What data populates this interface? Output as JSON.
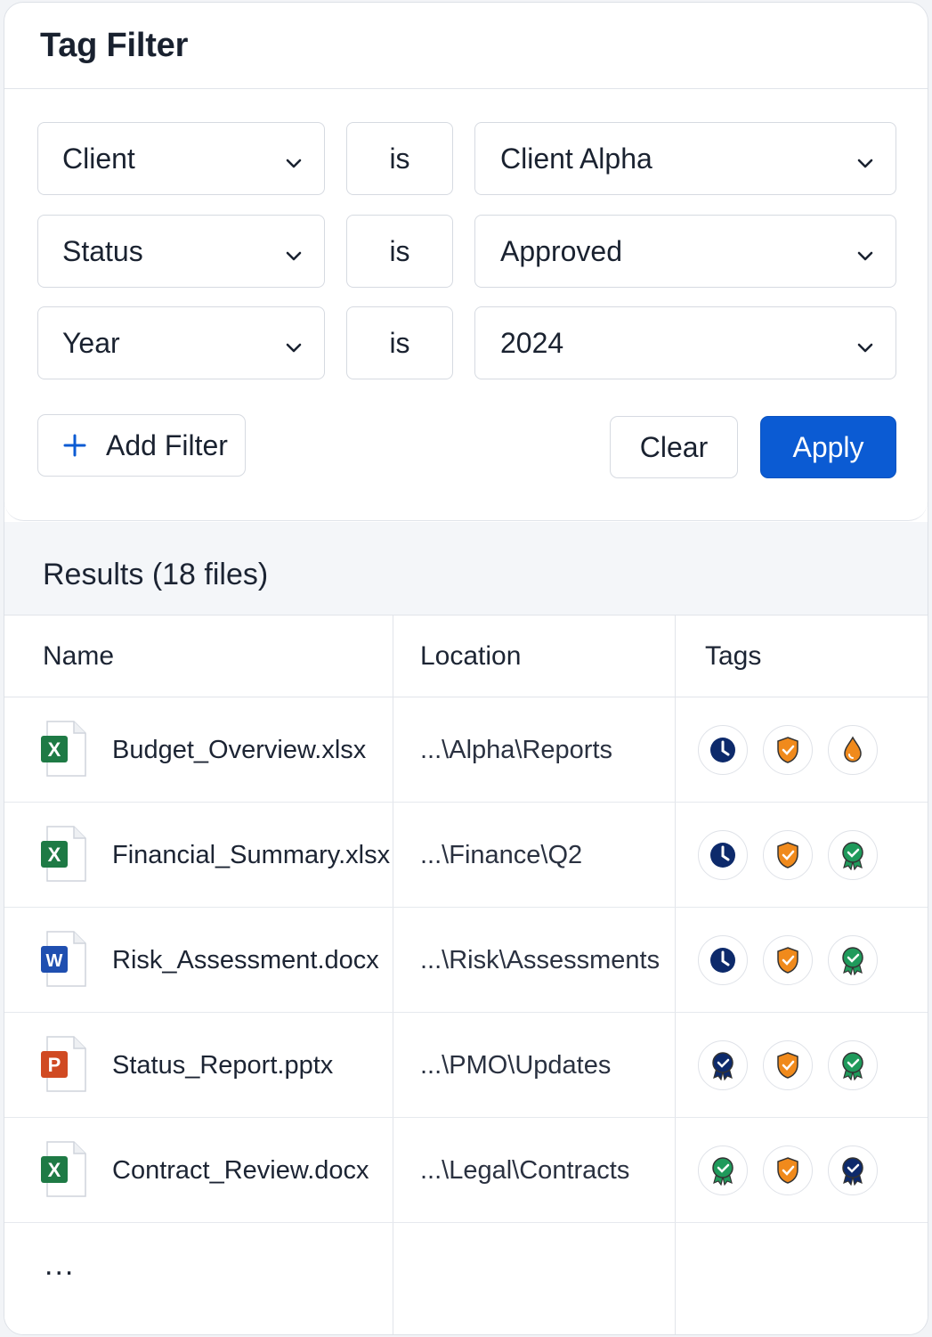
{
  "panel": {
    "title": "Tag Filter"
  },
  "filters": [
    {
      "key": "Client",
      "operator": "is",
      "value": "Client Alpha"
    },
    {
      "key": "Status",
      "operator": "is",
      "value": "Approved"
    },
    {
      "key": "Year",
      "operator": "is",
      "value": "2024"
    }
  ],
  "actions": {
    "add_filter": "Add Filter",
    "clear": "Clear",
    "apply": "Apply"
  },
  "results": {
    "title": "Results (18 files)",
    "columns": {
      "name": "Name",
      "location": "Location",
      "tags": "Tags"
    },
    "rows": [
      {
        "icon": "excel-file-icon",
        "name": "Budget_Overview.xlsx",
        "location": "...\\Alpha\\Reports",
        "tags": [
          "clock-icon",
          "shield-icon",
          "drop-icon"
        ]
      },
      {
        "icon": "excel-file-icon",
        "name": "Financial_Summary.xlsx",
        "location": "...\\Finance\\Q2",
        "tags": [
          "clock-icon",
          "shield-icon",
          "badge-green-icon"
        ]
      },
      {
        "icon": "word-file-icon",
        "name": "Risk_Assessment.docx",
        "location": "...\\Risk\\Assessments",
        "tags": [
          "clock-icon",
          "shield-icon",
          "badge-green-icon"
        ]
      },
      {
        "icon": "powerpoint-file-icon",
        "name": "Status_Report.pptx",
        "location": "...\\PMO\\Updates",
        "tags": [
          "badge-navy-icon",
          "shield-icon",
          "badge-green-icon"
        ]
      },
      {
        "icon": "excel-file-icon",
        "name": "Contract_Review.docx",
        "location": "...\\Legal\\Contracts",
        "tags": [
          "badge-green-icon",
          "shield-icon",
          "badge-navy-icon"
        ]
      }
    ],
    "more": "..."
  },
  "colors": {
    "accent": "#0b5bd3",
    "excel": "#1e7a45",
    "word": "#1f4fb0",
    "powerpoint": "#d04a22",
    "tag_navy": "#0d2a6b",
    "tag_orange": "#f08a1c",
    "tag_green": "#1f9a5b"
  }
}
